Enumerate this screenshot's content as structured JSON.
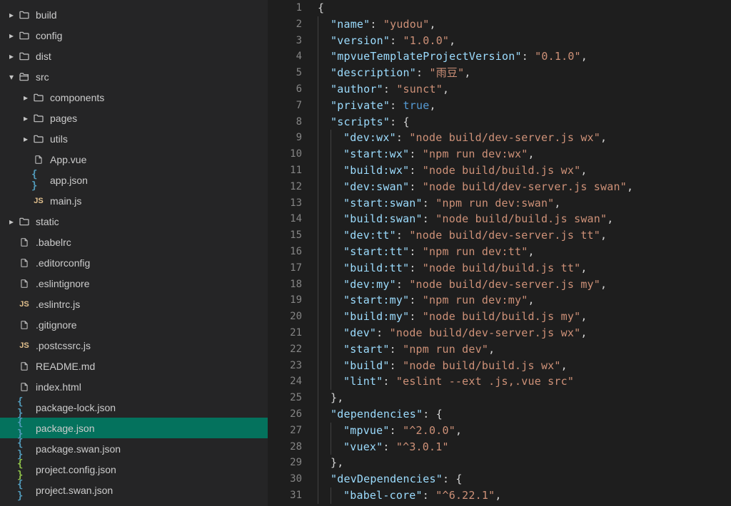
{
  "sidebar": {
    "items": [
      {
        "type": "folder",
        "label": "build",
        "indent": 0,
        "expanded": false,
        "icon": "folder"
      },
      {
        "type": "folder",
        "label": "config",
        "indent": 0,
        "expanded": false,
        "icon": "folder"
      },
      {
        "type": "folder",
        "label": "dist",
        "indent": 0,
        "expanded": false,
        "icon": "folder"
      },
      {
        "type": "folder",
        "label": "src",
        "indent": 0,
        "expanded": true,
        "icon": "folder-open"
      },
      {
        "type": "folder",
        "label": "components",
        "indent": 1,
        "expanded": false,
        "icon": "folder"
      },
      {
        "type": "folder",
        "label": "pages",
        "indent": 1,
        "expanded": false,
        "icon": "folder"
      },
      {
        "type": "folder",
        "label": "utils",
        "indent": 1,
        "expanded": false,
        "icon": "folder"
      },
      {
        "type": "file",
        "label": "App.vue",
        "indent": 1,
        "icon": "file"
      },
      {
        "type": "file",
        "label": "app.json",
        "indent": 1,
        "icon": "json-blue"
      },
      {
        "type": "file",
        "label": "main.js",
        "indent": 1,
        "icon": "js"
      },
      {
        "type": "folder",
        "label": "static",
        "indent": 0,
        "expanded": false,
        "icon": "folder"
      },
      {
        "type": "file",
        "label": ".babelrc",
        "indent": 0,
        "icon": "file"
      },
      {
        "type": "file",
        "label": ".editorconfig",
        "indent": 0,
        "icon": "file"
      },
      {
        "type": "file",
        "label": ".eslintignore",
        "indent": 0,
        "icon": "file"
      },
      {
        "type": "file",
        "label": ".eslintrc.js",
        "indent": 0,
        "icon": "js"
      },
      {
        "type": "file",
        "label": ".gitignore",
        "indent": 0,
        "icon": "file"
      },
      {
        "type": "file",
        "label": ".postcssrc.js",
        "indent": 0,
        "icon": "js"
      },
      {
        "type": "file",
        "label": "README.md",
        "indent": 0,
        "icon": "file"
      },
      {
        "type": "file",
        "label": "index.html",
        "indent": 0,
        "icon": "file"
      },
      {
        "type": "file",
        "label": "package-lock.json",
        "indent": 0,
        "icon": "json-blue"
      },
      {
        "type": "file",
        "label": "package.json",
        "indent": 0,
        "icon": "json-blue",
        "selected": true
      },
      {
        "type": "file",
        "label": "package.swan.json",
        "indent": 0,
        "icon": "json-blue"
      },
      {
        "type": "file",
        "label": "project.config.json",
        "indent": 0,
        "icon": "json-green"
      },
      {
        "type": "file",
        "label": "project.swan.json",
        "indent": 0,
        "icon": "json-blue"
      }
    ]
  },
  "editor": {
    "lines": [
      {
        "n": 1,
        "t": [
          {
            "c": "punc",
            "v": "{"
          }
        ],
        "i": 0
      },
      {
        "n": 2,
        "t": [
          {
            "c": "key",
            "v": "\"name\""
          },
          {
            "c": "punc",
            "v": ": "
          },
          {
            "c": "str",
            "v": "\"yudou\""
          },
          {
            "c": "punc",
            "v": ","
          }
        ],
        "i": 1
      },
      {
        "n": 3,
        "t": [
          {
            "c": "key",
            "v": "\"version\""
          },
          {
            "c": "punc",
            "v": ": "
          },
          {
            "c": "str",
            "v": "\"1.0.0\""
          },
          {
            "c": "punc",
            "v": ","
          }
        ],
        "i": 1
      },
      {
        "n": 4,
        "t": [
          {
            "c": "key",
            "v": "\"mpvueTemplateProjectVersion\""
          },
          {
            "c": "punc",
            "v": ": "
          },
          {
            "c": "str",
            "v": "\"0.1.0\""
          },
          {
            "c": "punc",
            "v": ","
          }
        ],
        "i": 1
      },
      {
        "n": 5,
        "t": [
          {
            "c": "key",
            "v": "\"description\""
          },
          {
            "c": "punc",
            "v": ": "
          },
          {
            "c": "str",
            "v": "\"雨豆\""
          },
          {
            "c": "punc",
            "v": ","
          }
        ],
        "i": 1
      },
      {
        "n": 6,
        "t": [
          {
            "c": "key",
            "v": "\"author\""
          },
          {
            "c": "punc",
            "v": ": "
          },
          {
            "c": "str",
            "v": "\"sunct\""
          },
          {
            "c": "punc",
            "v": ","
          }
        ],
        "i": 1
      },
      {
        "n": 7,
        "t": [
          {
            "c": "key",
            "v": "\"private\""
          },
          {
            "c": "punc",
            "v": ": "
          },
          {
            "c": "kw",
            "v": "true"
          },
          {
            "c": "punc",
            "v": ","
          }
        ],
        "i": 1
      },
      {
        "n": 8,
        "t": [
          {
            "c": "key",
            "v": "\"scripts\""
          },
          {
            "c": "punc",
            "v": ": {"
          }
        ],
        "i": 1
      },
      {
        "n": 9,
        "t": [
          {
            "c": "key",
            "v": "\"dev:wx\""
          },
          {
            "c": "punc",
            "v": ": "
          },
          {
            "c": "str",
            "v": "\"node build/dev-server.js wx\""
          },
          {
            "c": "punc",
            "v": ","
          }
        ],
        "i": 2
      },
      {
        "n": 10,
        "t": [
          {
            "c": "key",
            "v": "\"start:wx\""
          },
          {
            "c": "punc",
            "v": ": "
          },
          {
            "c": "str",
            "v": "\"npm run dev:wx\""
          },
          {
            "c": "punc",
            "v": ","
          }
        ],
        "i": 2
      },
      {
        "n": 11,
        "t": [
          {
            "c": "key",
            "v": "\"build:wx\""
          },
          {
            "c": "punc",
            "v": ": "
          },
          {
            "c": "str",
            "v": "\"node build/build.js wx\""
          },
          {
            "c": "punc",
            "v": ","
          }
        ],
        "i": 2
      },
      {
        "n": 12,
        "t": [
          {
            "c": "key",
            "v": "\"dev:swan\""
          },
          {
            "c": "punc",
            "v": ": "
          },
          {
            "c": "str",
            "v": "\"node build/dev-server.js swan\""
          },
          {
            "c": "punc",
            "v": ","
          }
        ],
        "i": 2
      },
      {
        "n": 13,
        "t": [
          {
            "c": "key",
            "v": "\"start:swan\""
          },
          {
            "c": "punc",
            "v": ": "
          },
          {
            "c": "str",
            "v": "\"npm run dev:swan\""
          },
          {
            "c": "punc",
            "v": ","
          }
        ],
        "i": 2
      },
      {
        "n": 14,
        "t": [
          {
            "c": "key",
            "v": "\"build:swan\""
          },
          {
            "c": "punc",
            "v": ": "
          },
          {
            "c": "str",
            "v": "\"node build/build.js swan\""
          },
          {
            "c": "punc",
            "v": ","
          }
        ],
        "i": 2
      },
      {
        "n": 15,
        "t": [
          {
            "c": "key",
            "v": "\"dev:tt\""
          },
          {
            "c": "punc",
            "v": ": "
          },
          {
            "c": "str",
            "v": "\"node build/dev-server.js tt\""
          },
          {
            "c": "punc",
            "v": ","
          }
        ],
        "i": 2
      },
      {
        "n": 16,
        "t": [
          {
            "c": "key",
            "v": "\"start:tt\""
          },
          {
            "c": "punc",
            "v": ": "
          },
          {
            "c": "str",
            "v": "\"npm run dev:tt\""
          },
          {
            "c": "punc",
            "v": ","
          }
        ],
        "i": 2
      },
      {
        "n": 17,
        "t": [
          {
            "c": "key",
            "v": "\"build:tt\""
          },
          {
            "c": "punc",
            "v": ": "
          },
          {
            "c": "str",
            "v": "\"node build/build.js tt\""
          },
          {
            "c": "punc",
            "v": ","
          }
        ],
        "i": 2
      },
      {
        "n": 18,
        "t": [
          {
            "c": "key",
            "v": "\"dev:my\""
          },
          {
            "c": "punc",
            "v": ": "
          },
          {
            "c": "str",
            "v": "\"node build/dev-server.js my\""
          },
          {
            "c": "punc",
            "v": ","
          }
        ],
        "i": 2
      },
      {
        "n": 19,
        "t": [
          {
            "c": "key",
            "v": "\"start:my\""
          },
          {
            "c": "punc",
            "v": ": "
          },
          {
            "c": "str",
            "v": "\"npm run dev:my\""
          },
          {
            "c": "punc",
            "v": ","
          }
        ],
        "i": 2
      },
      {
        "n": 20,
        "t": [
          {
            "c": "key",
            "v": "\"build:my\""
          },
          {
            "c": "punc",
            "v": ": "
          },
          {
            "c": "str",
            "v": "\"node build/build.js my\""
          },
          {
            "c": "punc",
            "v": ","
          }
        ],
        "i": 2
      },
      {
        "n": 21,
        "t": [
          {
            "c": "key",
            "v": "\"dev\""
          },
          {
            "c": "punc",
            "v": ": "
          },
          {
            "c": "str",
            "v": "\"node build/dev-server.js wx\""
          },
          {
            "c": "punc",
            "v": ","
          }
        ],
        "i": 2
      },
      {
        "n": 22,
        "t": [
          {
            "c": "key",
            "v": "\"start\""
          },
          {
            "c": "punc",
            "v": ": "
          },
          {
            "c": "str",
            "v": "\"npm run dev\""
          },
          {
            "c": "punc",
            "v": ","
          }
        ],
        "i": 2
      },
      {
        "n": 23,
        "t": [
          {
            "c": "key",
            "v": "\"build\""
          },
          {
            "c": "punc",
            "v": ": "
          },
          {
            "c": "str",
            "v": "\"node build/build.js wx\""
          },
          {
            "c": "punc",
            "v": ","
          }
        ],
        "i": 2
      },
      {
        "n": 24,
        "t": [
          {
            "c": "key",
            "v": "\"lint\""
          },
          {
            "c": "punc",
            "v": ": "
          },
          {
            "c": "str",
            "v": "\"eslint --ext .js,.vue src\""
          }
        ],
        "i": 2
      },
      {
        "n": 25,
        "t": [
          {
            "c": "punc",
            "v": "},"
          }
        ],
        "i": 1
      },
      {
        "n": 26,
        "t": [
          {
            "c": "key",
            "v": "\"dependencies\""
          },
          {
            "c": "punc",
            "v": ": {"
          }
        ],
        "i": 1
      },
      {
        "n": 27,
        "t": [
          {
            "c": "key",
            "v": "\"mpvue\""
          },
          {
            "c": "punc",
            "v": ": "
          },
          {
            "c": "str",
            "v": "\"^2.0.0\""
          },
          {
            "c": "punc",
            "v": ","
          }
        ],
        "i": 2
      },
      {
        "n": 28,
        "t": [
          {
            "c": "key",
            "v": "\"vuex\""
          },
          {
            "c": "punc",
            "v": ": "
          },
          {
            "c": "str",
            "v": "\"^3.0.1\""
          }
        ],
        "i": 2
      },
      {
        "n": 29,
        "t": [
          {
            "c": "punc",
            "v": "},"
          }
        ],
        "i": 1
      },
      {
        "n": 30,
        "t": [
          {
            "c": "key",
            "v": "\"devDependencies\""
          },
          {
            "c": "punc",
            "v": ": {"
          }
        ],
        "i": 1
      },
      {
        "n": 31,
        "t": [
          {
            "c": "key",
            "v": "\"babel-core\""
          },
          {
            "c": "punc",
            "v": ": "
          },
          {
            "c": "str",
            "v": "\"^6.22.1\""
          },
          {
            "c": "punc",
            "v": ","
          }
        ],
        "i": 2
      }
    ]
  }
}
